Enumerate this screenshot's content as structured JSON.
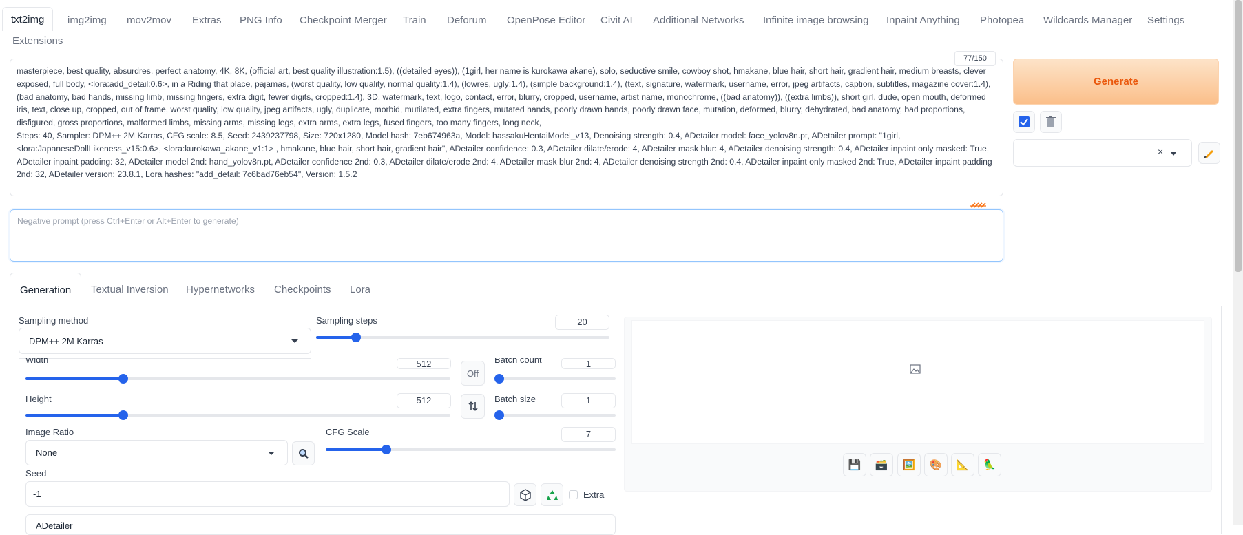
{
  "tabs": [
    "txt2img",
    "img2img",
    "mov2mov",
    "Extras",
    "PNG Info",
    "Checkpoint Merger",
    "Train",
    "Deforum",
    "OpenPose Editor",
    "Civit AI",
    "Additional Networks",
    "Infinite image browsing",
    "Inpaint Anything",
    "Photopea",
    "Wildcards Manager",
    "Settings",
    "Extensions"
  ],
  "prompt": {
    "token_count": "77/150",
    "text": "masterpiece, best quality, absurdres, perfect anatomy, 4K, 8K, (official art, best quality illustration:1.5), ((detailed eyes)), (1girl, her name is kurokawa akane), solo, seductive smile, cowboy shot, hmakane, blue hair, short hair, gradient hair, medium breasts, clever exposed, full body, <lora:add_detail:0.6>, in a Riding that place, pajamas, (worst quality, low quality, normal quality:1.4), (lowres, ugly:1.4), (simple background:1.4), (text, signature, watermark, username, error, jpeg artifacts, caption, subtitles, magazine cover:1.4), (bad anatomy, bad hands, missing limb, missing fingers, extra digit, fewer digits, cropped:1.4), 3D, watermark, text, logo, contact, error, blurry, cropped, username, artist name, monochrome, ((bad anatomy)), ((extra limbs)), short girl, dude, open mouth, deformed iris, text, close up, cropped, out of frame, worst quality, low quality, jpeg artifacts, ugly, duplicate, morbid, mutilated, extra fingers, mutated hands, poorly drawn hands, poorly drawn face, mutation, deformed, blurry, dehydrated, bad anatomy, bad proportions, disfigured, gross proportions, malformed limbs, missing arms, missing legs, extra arms, extra legs, fused fingers, too many fingers, long neck,",
    "text2": "Steps: 40, Sampler: DPM++ 2M Karras, CFG scale: 8.5, Seed: 2439237798, Size: 720x1280, Model hash: 7eb674963a, Model: hassakuHentaiModel_v13, Denoising strength: 0.4, ADetailer model: face_yolov8n.pt, ADetailer prompt: \"1girl, <lora:JapaneseDollLikeness_v15:0.6>, <lora:kurokawa_akane_v1:1> , hmakane, blue hair, short hair, gradient hair\", ADetailer confidence: 0.3, ADetailer dilate/erode: 4, ADetailer mask blur: 4, ADetailer denoising strength: 0.4, ADetailer inpaint only masked: True, ADetailer inpaint padding: 32, ADetailer model 2nd: hand_yolov8n.pt, ADetailer confidence 2nd: 0.3, ADetailer dilate/erode 2nd: 4, ADetailer mask blur 2nd: 4, ADetailer denoising strength 2nd: 0.4, ADetailer inpaint only masked 2nd: True, ADetailer inpaint padding 2nd: 32, ADetailer version: 23.8.1, Lora hashes: \"add_detail: 7c6bad76eb54\", Version: 1.5.2",
    "negative_placeholder": "Negative prompt (press Ctrl+Enter or Alt+Enter to generate)"
  },
  "generate_label": "Generate",
  "subtabs": [
    "Generation",
    "Textual Inversion",
    "Hypernetworks",
    "Checkpoints",
    "Lora"
  ],
  "generation": {
    "sampling_method_label": "Sampling method",
    "sampling_method_value": "DPM++ 2M Karras",
    "sampling_steps_label": "Sampling steps",
    "sampling_steps_value": "20",
    "sampling_steps_fraction": 0.136,
    "width_label": "Width",
    "width_value": "512",
    "width_fraction": 0.23,
    "height_label": "Height",
    "height_value": "512",
    "height_fraction": 0.23,
    "off_label": "Off",
    "batch_count_label": "Batch count",
    "batch_count_value": "1",
    "batch_size_label": "Batch size",
    "batch_size_value": "1",
    "image_ratio_label": "Image Ratio",
    "image_ratio_value": "None",
    "cfg_label": "CFG Scale",
    "cfg_value": "7",
    "cfg_fraction": 0.21,
    "seed_label": "Seed",
    "seed_value": "-1",
    "extra_label": "Extra",
    "adetailer_label": "ADetailer"
  },
  "colors": {
    "accent": "#2563eb",
    "generate_text": "#ea580c"
  }
}
